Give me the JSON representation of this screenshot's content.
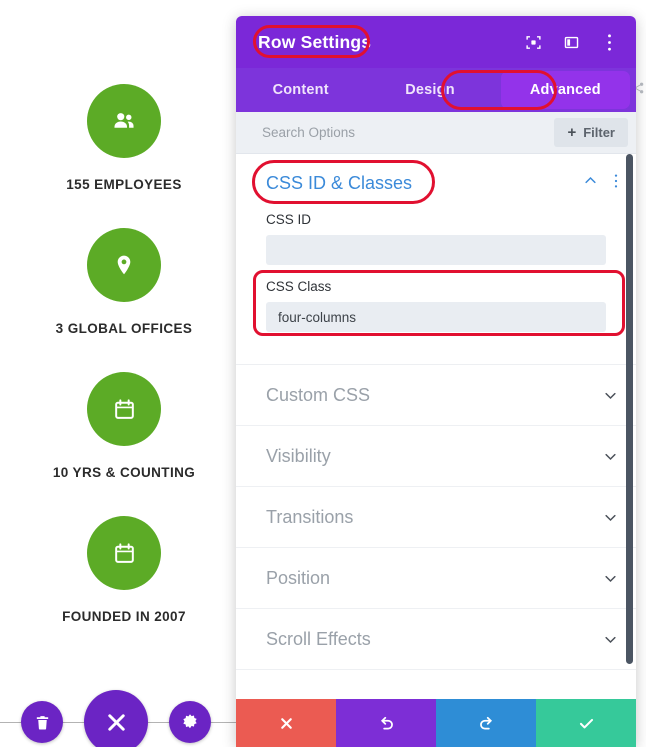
{
  "page": {
    "stats": [
      {
        "icon": "people-icon",
        "label": "155 EMPLOYEES"
      },
      {
        "icon": "map-pin-icon",
        "label": "3 GLOBAL OFFICES"
      },
      {
        "icon": "calendar-icon",
        "label": "10 YRS & COUNTING"
      },
      {
        "icon": "calendar-icon",
        "label": "FOUNDED IN 2007"
      }
    ],
    "circle_color": "#5cab26",
    "label_color": "#2b2b2b"
  },
  "page_controls": [
    {
      "name": "delete-row-button",
      "icon": "trash-icon"
    },
    {
      "name": "close-builder-button",
      "icon": "close-x-icon"
    },
    {
      "name": "settings-button",
      "icon": "gear-icon"
    }
  ],
  "modal": {
    "title": "Row Settings",
    "header_color": "#7b28d8",
    "header_icons": [
      {
        "name": "expand-view-icon",
        "icon": "expand-icon"
      },
      {
        "name": "split-view-icon",
        "icon": "columns-icon"
      },
      {
        "name": "more-options-icon",
        "icon": "kebab-menu-icon"
      }
    ],
    "tabs": [
      {
        "label": "Content",
        "active": false
      },
      {
        "label": "Design",
        "active": false
      },
      {
        "label": "Advanced",
        "active": true
      }
    ],
    "active_tab_color": "#9333ea",
    "search": {
      "value": "",
      "placeholder": "Search Options"
    },
    "filter_button": {
      "label": "Filter",
      "plus": "+"
    },
    "open_section": {
      "title": "CSS ID & Classes",
      "title_color": "#3b8ad9",
      "collapse_icon": "chevron-up-icon",
      "menu_icon": "kebab-menu-icon",
      "fields": [
        {
          "label": "CSS ID",
          "value": "",
          "placeholder": ""
        },
        {
          "label": "CSS Class",
          "value": "four-columns",
          "placeholder": ""
        }
      ]
    },
    "sections": [
      {
        "title": "Custom CSS",
        "chevron": "chevron-down-icon"
      },
      {
        "title": "Visibility",
        "chevron": "chevron-down-icon"
      },
      {
        "title": "Transitions",
        "chevron": "chevron-down-icon"
      },
      {
        "title": "Position",
        "chevron": "chevron-down-icon"
      },
      {
        "title": "Scroll Effects",
        "chevron": "chevron-down-icon"
      }
    ],
    "footer_buttons": [
      {
        "name": "cancel-button",
        "icon": "close-x-icon",
        "color": "#eb5b52"
      },
      {
        "name": "undo-button",
        "icon": "undo-arrow-icon",
        "color": "#7d2ed6"
      },
      {
        "name": "redo-button",
        "icon": "redo-arrow-icon",
        "color": "#2e8dd6"
      },
      {
        "name": "save-button",
        "icon": "checkmark-icon",
        "color": "#36c99a"
      }
    ]
  },
  "annotations": {
    "highlight_color": "#e11030",
    "boxes": [
      "Row Settings",
      "Advanced",
      "CSS ID & Classes",
      "CSS Class"
    ]
  }
}
